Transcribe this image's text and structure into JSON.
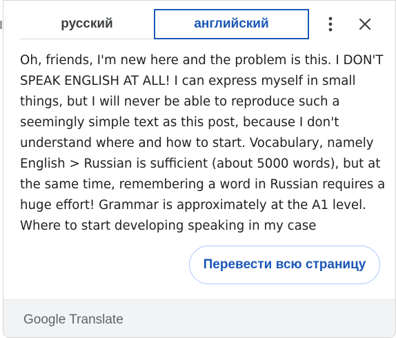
{
  "popup": {
    "source_language": "русский",
    "target_language": "английский",
    "menu_icon": "more-vert-icon",
    "close_icon": "close-icon",
    "translated_text": "Oh, friends, I'm new here and the problem is this. I DON'T SPEAK ENGLISH AT ALL! I can express myself in small things, but I will never be able to reproduce such a seemingly simple text as this post, because I don't understand where and how to start. Vocabulary, namely English > Russian is sufficient (about 5000 words), but at the same time, remembering a word in Russian requires a huge effort! Grammar is approximately at the A1 level. Where to start developing speaking in my case",
    "translate_page_label": "Перевести всю страницу"
  },
  "footer": {
    "brand_google": "Google",
    "brand_translate": "Translate"
  },
  "colors": {
    "accent": "#1a57b8",
    "text": "#202124",
    "muted": "#5f6368",
    "footer_bg": "#f1f3f4"
  }
}
